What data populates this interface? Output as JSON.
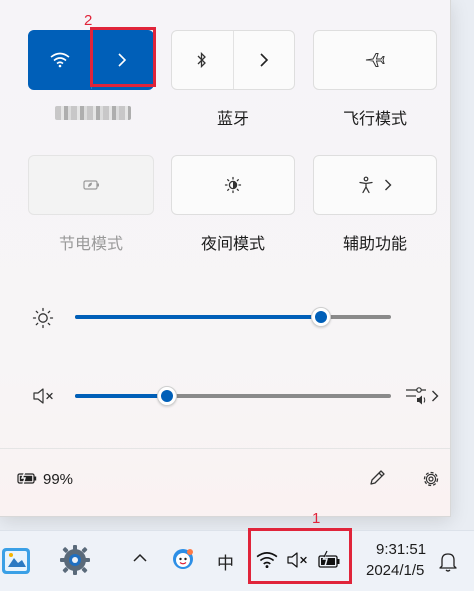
{
  "quick_settings": {
    "wifi_network_name": "",
    "tiles": {
      "bluetooth": "蓝牙",
      "airplane_mode": "飞行模式",
      "battery_saver": "节电模式",
      "night_light": "夜间模式",
      "accessibility": "辅助功能"
    },
    "brightness": {
      "value": 0.78
    },
    "volume": {
      "value": 0.29
    },
    "battery_percent": "99%"
  },
  "taskbar": {
    "ime": "中",
    "time": "9:31:51",
    "date": "2024/1/5"
  },
  "annotations": {
    "marker_1": "1",
    "marker_2": "2",
    "color": "#e0243a"
  },
  "colors": {
    "accent": "#005fb8",
    "panel_bg": "#f6f4f8",
    "taskbar_bg": "#eef2f8"
  }
}
